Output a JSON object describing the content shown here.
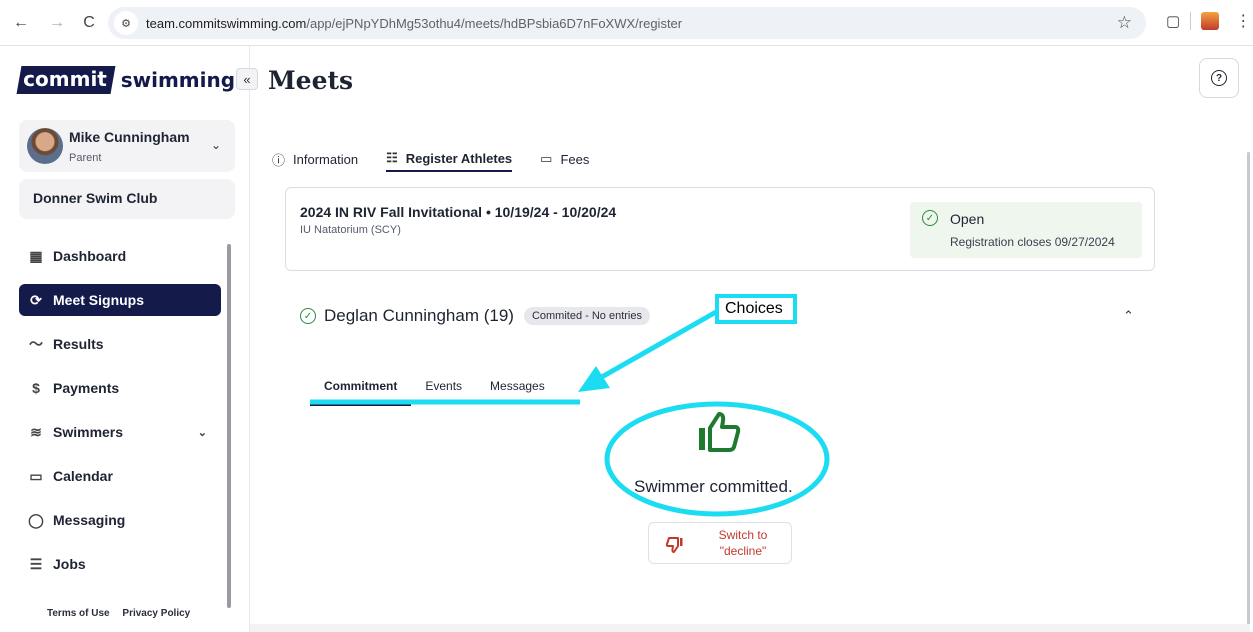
{
  "browser": {
    "url_host": "team.commitswimming.com",
    "url_path": "/app/ejPNpYDhMg53othu4/meets/hdBPsbia6D7nFoXWX/register"
  },
  "sidebar": {
    "logo_commit": "commit",
    "logo_swimming": "swimming",
    "collapse_label": "«",
    "user": {
      "name": "Mike Cunningham",
      "role": "Parent"
    },
    "club": "Donner Swim Club",
    "items": [
      {
        "label": "Dashboard",
        "icon": "dashboard-icon",
        "active": false
      },
      {
        "label": "Meet Signups",
        "icon": "meet-signups-icon",
        "active": true
      },
      {
        "label": "Results",
        "icon": "results-icon",
        "active": false
      },
      {
        "label": "Payments",
        "icon": "payments-icon",
        "active": false
      },
      {
        "label": "Swimmers",
        "icon": "swimmers-icon",
        "active": false
      },
      {
        "label": "Calendar",
        "icon": "calendar-icon",
        "active": false
      },
      {
        "label": "Messaging",
        "icon": "messaging-icon",
        "active": false
      },
      {
        "label": "Jobs",
        "icon": "jobs-icon",
        "active": false
      }
    ],
    "footer": {
      "terms": "Terms of Use",
      "privacy": "Privacy Policy"
    }
  },
  "main": {
    "title": "Meets",
    "tabs": [
      {
        "label": "Information",
        "active": false
      },
      {
        "label": "Register Athletes",
        "active": true
      },
      {
        "label": "Fees",
        "active": false
      }
    ],
    "meet": {
      "title": "2024 IN RIV Fall Invitational • 10/19/24 - 10/20/24",
      "venue": "IU Natatorium (SCY)",
      "status": "Open",
      "closes": "Registration closes 09/27/2024"
    },
    "athlete": {
      "name": "Deglan Cunningham (19)",
      "badge": "Commited - No entries"
    },
    "sub_tabs": [
      {
        "label": "Commitment",
        "active": true
      },
      {
        "label": "Events",
        "active": false
      },
      {
        "label": "Messages",
        "active": false
      }
    ],
    "committed_text": "Swimmer committed.",
    "switch_line1": "Switch to",
    "switch_line2": "\"decline\""
  },
  "annotation": {
    "label": "Choices",
    "color": "#1cdcf2"
  },
  "colors": {
    "brand_navy": "#141a4a",
    "success_green": "#2f8a3b",
    "decline_red": "#c0392b"
  }
}
